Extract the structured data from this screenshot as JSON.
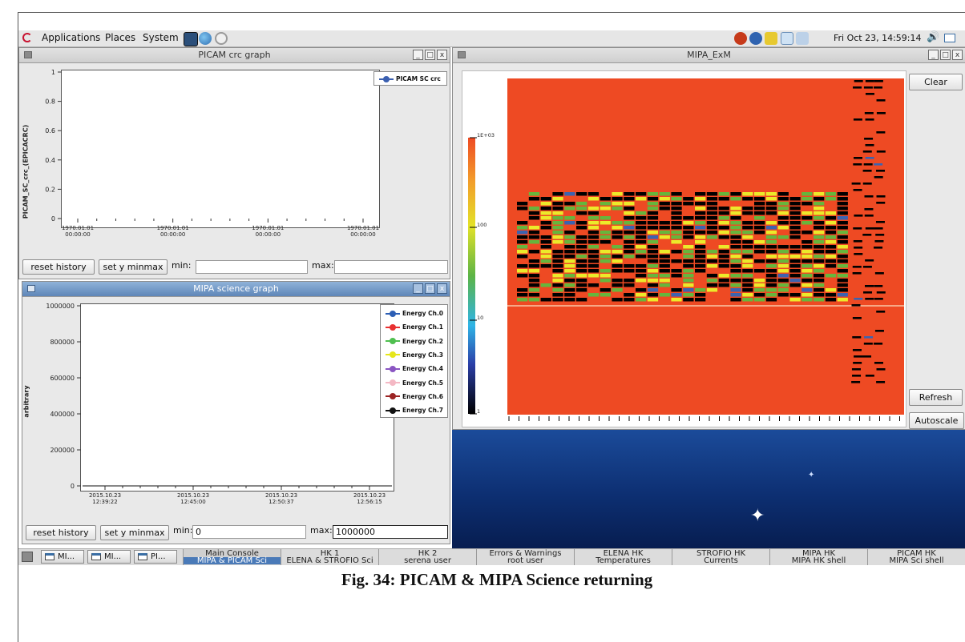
{
  "top_panel": {
    "menus": [
      "Applications",
      "Places",
      "System"
    ],
    "clock": "Fri Oct 23, 14:59:14"
  },
  "crc_window": {
    "title": "PICAM crc graph",
    "win_buttons": [
      "_",
      "□",
      "x"
    ],
    "chart_data": {
      "type": "line",
      "ylabel": "PICAM_SC_crc_(EPICACRC)",
      "yticks": [
        "0",
        "0.2",
        "0.4",
        "0.6",
        "0.8",
        "1"
      ],
      "ylim": [
        0,
        1
      ],
      "xticks": [
        {
          "date": "1970.01.01",
          "time": "00:00:00"
        },
        {
          "date": "1970.01.01",
          "time": "00:00:00"
        },
        {
          "date": "1970.01.01",
          "time": "00:00:00"
        },
        {
          "date": "1970.01.01",
          "time": "00:00:00"
        }
      ],
      "series": [
        {
          "name": "PICAM SC crc",
          "color": "#3a5fb0",
          "values": []
        }
      ]
    },
    "reset_label": "reset history",
    "setminmax_label": "set y minmax",
    "min_label": "min:",
    "min_value": "",
    "max_label": "max:",
    "max_value": ""
  },
  "mipa_window": {
    "title": "MIPA science graph",
    "win_buttons": [
      "_",
      "□",
      "x"
    ],
    "chart_data": {
      "type": "line",
      "ylabel": "arbitrary",
      "yticks": [
        "0",
        "200000",
        "400000",
        "600000",
        "800000",
        "1000000"
      ],
      "ylim": [
        0,
        1000000
      ],
      "xticks": [
        {
          "date": "2015.10.23",
          "time": "12:39:22"
        },
        {
          "date": "2015.10.23",
          "time": "12:45:00"
        },
        {
          "date": "2015.10.23",
          "time": "12:50:37"
        },
        {
          "date": "2015.10.23",
          "time": "12:56:15"
        }
      ],
      "series": [
        {
          "name": "Energy Ch.0",
          "color": "#2d5fb5",
          "values": [
            0,
            0
          ]
        },
        {
          "name": "Energy Ch.1",
          "color": "#e83030",
          "values": [
            0,
            0
          ]
        },
        {
          "name": "Energy Ch.2",
          "color": "#4fbf4f",
          "values": [
            0,
            0
          ]
        },
        {
          "name": "Energy Ch.3",
          "color": "#e6e61a",
          "values": [
            0,
            0
          ]
        },
        {
          "name": "Energy Ch.4",
          "color": "#8a55c2",
          "values": [
            0,
            0
          ]
        },
        {
          "name": "Energy Ch.5",
          "color": "#f4b8c4",
          "values": [
            0,
            0
          ]
        },
        {
          "name": "Energy Ch.6",
          "color": "#9c2424",
          "values": [
            0,
            0
          ]
        },
        {
          "name": "Energy Ch.7",
          "color": "#111111",
          "values": [
            0,
            0
          ]
        }
      ]
    },
    "reset_label": "reset history",
    "setminmax_label": "set y minmax",
    "min_label": "min:",
    "min_value": "0",
    "max_label": "max:",
    "max_value": "1000000"
  },
  "exm_window": {
    "title": "MIPA_ExM",
    "win_buttons": [
      "_",
      "□",
      "x"
    ],
    "clear_label": "Clear",
    "refresh_label": "Refresh",
    "autoscale_label": "Autoscale",
    "colorbar": {
      "labels": [
        "1E+03",
        "100",
        "10",
        "1"
      ]
    },
    "colors": {
      "background": "#ee4a23",
      "green": "#66b63c",
      "yellow": "#ecea2a",
      "blue": "#3c63b0",
      "black": "#000000"
    }
  },
  "taskbar": {
    "windows": [
      "MI...",
      "MI...",
      "PI..."
    ],
    "tabs": [
      {
        "line1": "Main Console",
        "line2": "MIPA & PICAM Sci",
        "selected": true
      },
      {
        "line1": "HK 1",
        "line2": "ELENA & STROFIO Sci",
        "selected": false
      },
      {
        "line1": "HK 2",
        "line2": "serena user",
        "selected": false
      },
      {
        "line1": "Errors & Warnings",
        "line2": "root user",
        "selected": false
      },
      {
        "line1": "ELENA HK",
        "line2": "Temperatures",
        "selected": false
      },
      {
        "line1": "STROFIO HK",
        "line2": "Currents",
        "selected": false
      },
      {
        "line1": "MIPA HK",
        "line2": "MIPA HK shell",
        "selected": false
      },
      {
        "line1": "PICAM HK",
        "line2": "MIPA Sci shell",
        "selected": false
      }
    ]
  },
  "caption": "Fig. 34: PICAM & MIPA Science returning"
}
